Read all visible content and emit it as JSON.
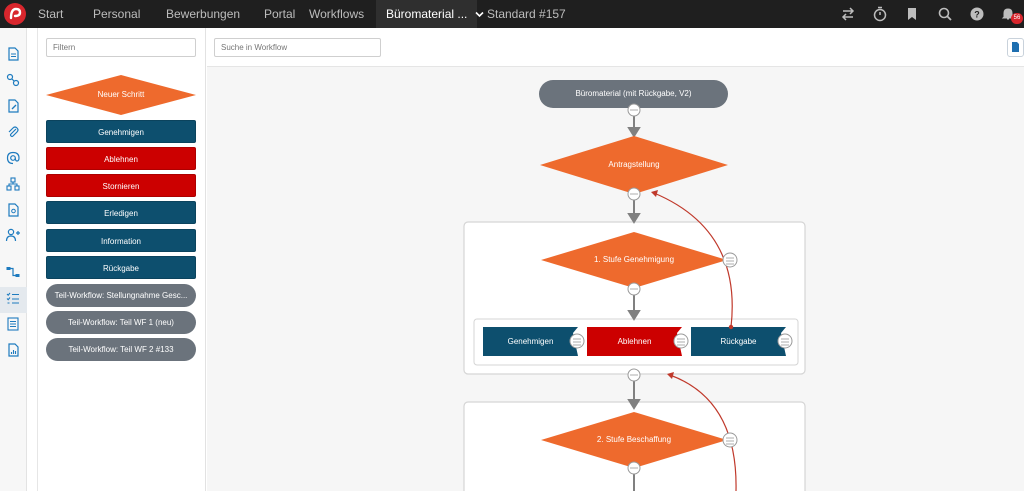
{
  "topbar": {
    "nav": [
      "Start",
      "Personal",
      "Bewerbungen",
      "Portal",
      "Workflows"
    ],
    "active_tab": "Büromaterial ...",
    "secondary_tab": "Standard #157",
    "notification_count": "56"
  },
  "rail": {
    "icons": [
      "document-icon",
      "users-link-icon",
      "file-edit-icon",
      "attachment-icon",
      "at-sign-icon",
      "org-chart-icon",
      "contract-icon",
      "add-user-icon",
      "workflow-icon",
      "checklist-icon",
      "list-icon",
      "report-icon"
    ]
  },
  "palette": {
    "filter_placeholder": "Filtern",
    "new_step": "Neuer Schritt",
    "buttons": [
      {
        "label": "Genehmigen",
        "color": "#0d4f6e"
      },
      {
        "label": "Ablehnen",
        "color": "#cc0000"
      },
      {
        "label": "Stornieren",
        "color": "#cc0000"
      },
      {
        "label": "Erledigen",
        "color": "#0d4f6e"
      },
      {
        "label": "Information",
        "color": "#0d4f6e"
      },
      {
        "label": "Rückgabe",
        "color": "#0d4f6e"
      }
    ],
    "subflows": [
      "Teil-Workflow: Stellungnahme Gesc...",
      "Teil-Workflow: Teil WF 1 (neu)",
      "Teil-Workflow: Teil WF 2 #133"
    ]
  },
  "workflow": {
    "search_placeholder": "Suche in Workflow",
    "start_node": "Büromaterial (mit Rückgabe, V2)",
    "step1": "Antragstellung",
    "step2": "1. Stufe Genehmigung",
    "actions": [
      "Genehmigen",
      "Ablehnen",
      "Rückgabe"
    ],
    "step3": "2. Stufe Beschaffung"
  },
  "colors": {
    "orange": "#ee6a2d",
    "blue": "#0d4f6e",
    "red": "#cc0000",
    "grey": "#6b737c"
  }
}
